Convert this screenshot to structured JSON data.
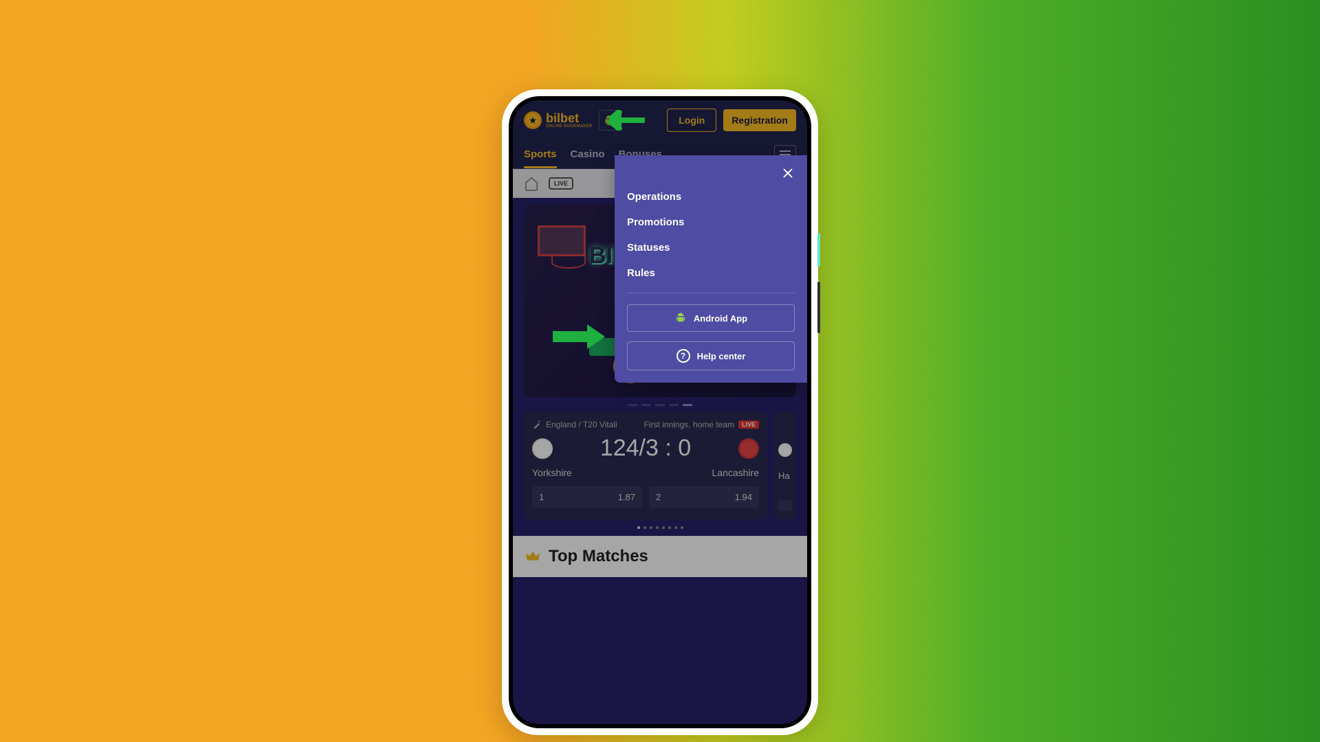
{
  "brand": {
    "name": "bilbet",
    "tagline": "ONLINE BOOKMAKER"
  },
  "header": {
    "login_label": "Login",
    "register_label": "Registration"
  },
  "nav": {
    "tabs": [
      "Sports",
      "Casino",
      "Bonuses"
    ],
    "live_label": "LIVE"
  },
  "banner": {
    "title_fragment": "BIL"
  },
  "popup": {
    "items": [
      "Operations",
      "Promotions",
      "Statuses",
      "Rules"
    ],
    "android_label": "Android App",
    "help_label": "Help center"
  },
  "match": {
    "league": "England / T20 Vitali",
    "status": "First innings, home team",
    "live_tag": "LIVE",
    "score": "124/3 : 0",
    "team_home": "Yorkshire",
    "team_away": "Lancashire",
    "peek_team": "Ha",
    "odds": [
      {
        "label": "1",
        "value": "1.87"
      },
      {
        "label": "2",
        "value": "1.94"
      }
    ]
  },
  "top_matches": {
    "title": "Top Matches"
  },
  "colors": {
    "accent": "#fbbf24",
    "popup_bg": "#4e4ca3",
    "arrow": "#1fb03f"
  }
}
